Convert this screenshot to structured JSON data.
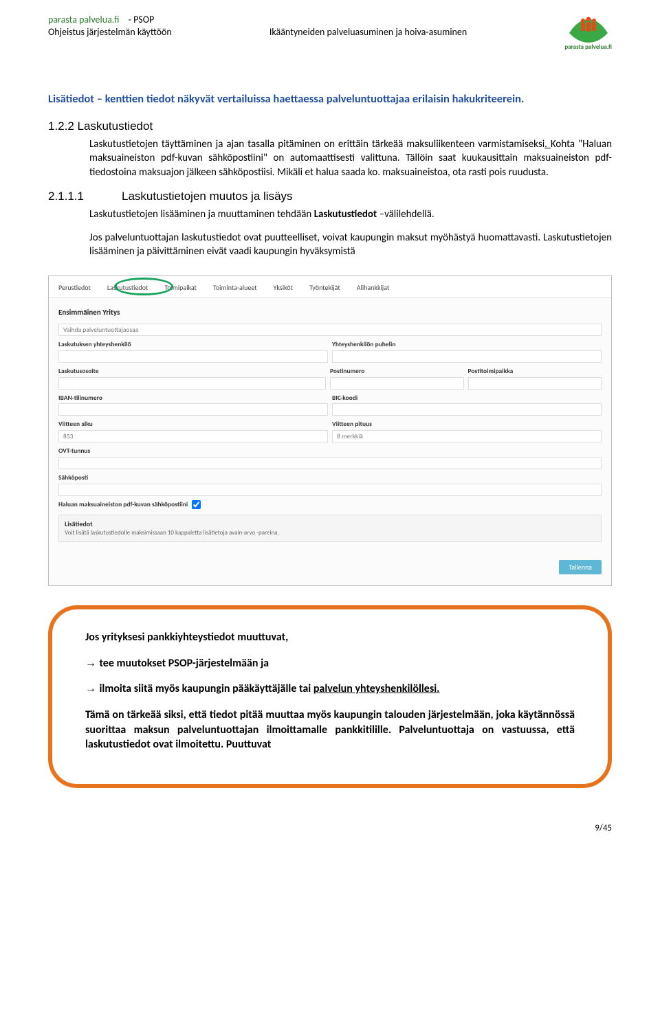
{
  "header": {
    "brand_link": "parasta palvelua.fi",
    "psop": "- PSOP",
    "left_line2": "Ohjeistus järjestelmän käyttöön",
    "center": "Ikääntyneiden palveluasuminen ja hoiva-asuminen",
    "logo_caption": "parasta palvelua.fi"
  },
  "lead_sentence": "Lisätiedot – kenttien tiedot näkyvät vertailuissa haettaessa palveluntuottajaa erilaisin hakukriteerein.",
  "section": {
    "num": "1.2.2 ",
    "title": "Laskutustiedot",
    "para_pre": "Laskutustietojen täyttäminen ja ajan tasalla pitäminen on erittäin tärkeää maksuliikenteen varmistamiseksi",
    "para_dot": ". ",
    "para_after": "Kohta \"Haluan maksuaineiston pdf-kuvan sähköpostiini\" on automaattisesti valittuna. Tällöin saat kuukausittain maksuaineiston pdf-tiedostoina maksuajon jälkeen sähköpostiisi. Mikäli et halua saada ko. maksuaineistoa, ota rasti pois ruudusta."
  },
  "subsection": {
    "num": "2.1.1.1",
    "title": "Laskutustietojen muutos ja lisäys",
    "para1_pre": "Laskutustietojen lisääminen ja muuttaminen tehdään ",
    "para1_bold": "Laskutustiedot",
    "para1_post": " –välilehdellä.",
    "para2": "Jos palveluntuottajan laskutustiedot ovat puutteelliset, voivat kaupungin maksut myöhästyä huomattavasti. Laskutustietojen lisääminen ja päivittäminen eivät vaadi kaupungin hyväksymistä"
  },
  "form": {
    "tabs": [
      "Perustiedot",
      "Laskutustiedot",
      "Toimipaikat",
      "Toiminta-alueet",
      "Yksiköt",
      "Työntekijät",
      "Alihankkijat"
    ],
    "company": "Ensimmäinen Yritys",
    "switch_placeholder": "Vaihda palveluntuottajaosaa",
    "labels": {
      "laskutuksen_yhteyshenkilo": "Laskutuksen yhteyshenkilö",
      "yhteyshenkilon_puhelin": "Yhteyshenkilön puhelin",
      "laskutusosoite": "Laskutusosoite",
      "postinumero": "Postinumero",
      "postitoimipaikka": "Postitoimipaikka",
      "iban": "IBAN-tilinumero",
      "bic": "BIC-koodi",
      "viitteen_alku": "Viitteen alku",
      "viitteen_pituus": "Viitteen pituus",
      "ovt": "OVT-tunnus",
      "email": "Sähköposti",
      "pdf_checkbox": "Haluan maksuaineiston pdf-kuvan sähköpostiini",
      "viite_value": "853",
      "viitteen_pituus_value": "8 merkkiä"
    },
    "accordion": {
      "title": "Lisätiedot",
      "sub": "Voit lisätä laskutustiedolle maksimissaan 10 kappaletta lisätietoja avain-arvo -pareina."
    },
    "save": "Tallenna"
  },
  "callout": {
    "l1": "Jos yrityksesi pankkiyhteystiedot muuttuvat,",
    "l2_arrow": "→ ",
    "l2": "tee muutokset PSOP-järjestelmään ja",
    "l3_arrow": "→ ",
    "l3_pre": "ilmoita siitä myös kaupungin pääkäyttäjälle tai ",
    "l3_under": "palvelun yhteyshenkilöllesi.",
    "l4": "Tämä on tärkeää siksi, että tiedot pitää muuttaa myös kaupungin talouden järjestelmään, joka käytännössä suorittaa maksun palveluntuottajan ilmoittamalle pankkitilille. Palveluntuottaja on vastuussa, että laskutustiedot ovat ilmoitettu. Puuttuvat"
  },
  "page_footer": "9/45"
}
